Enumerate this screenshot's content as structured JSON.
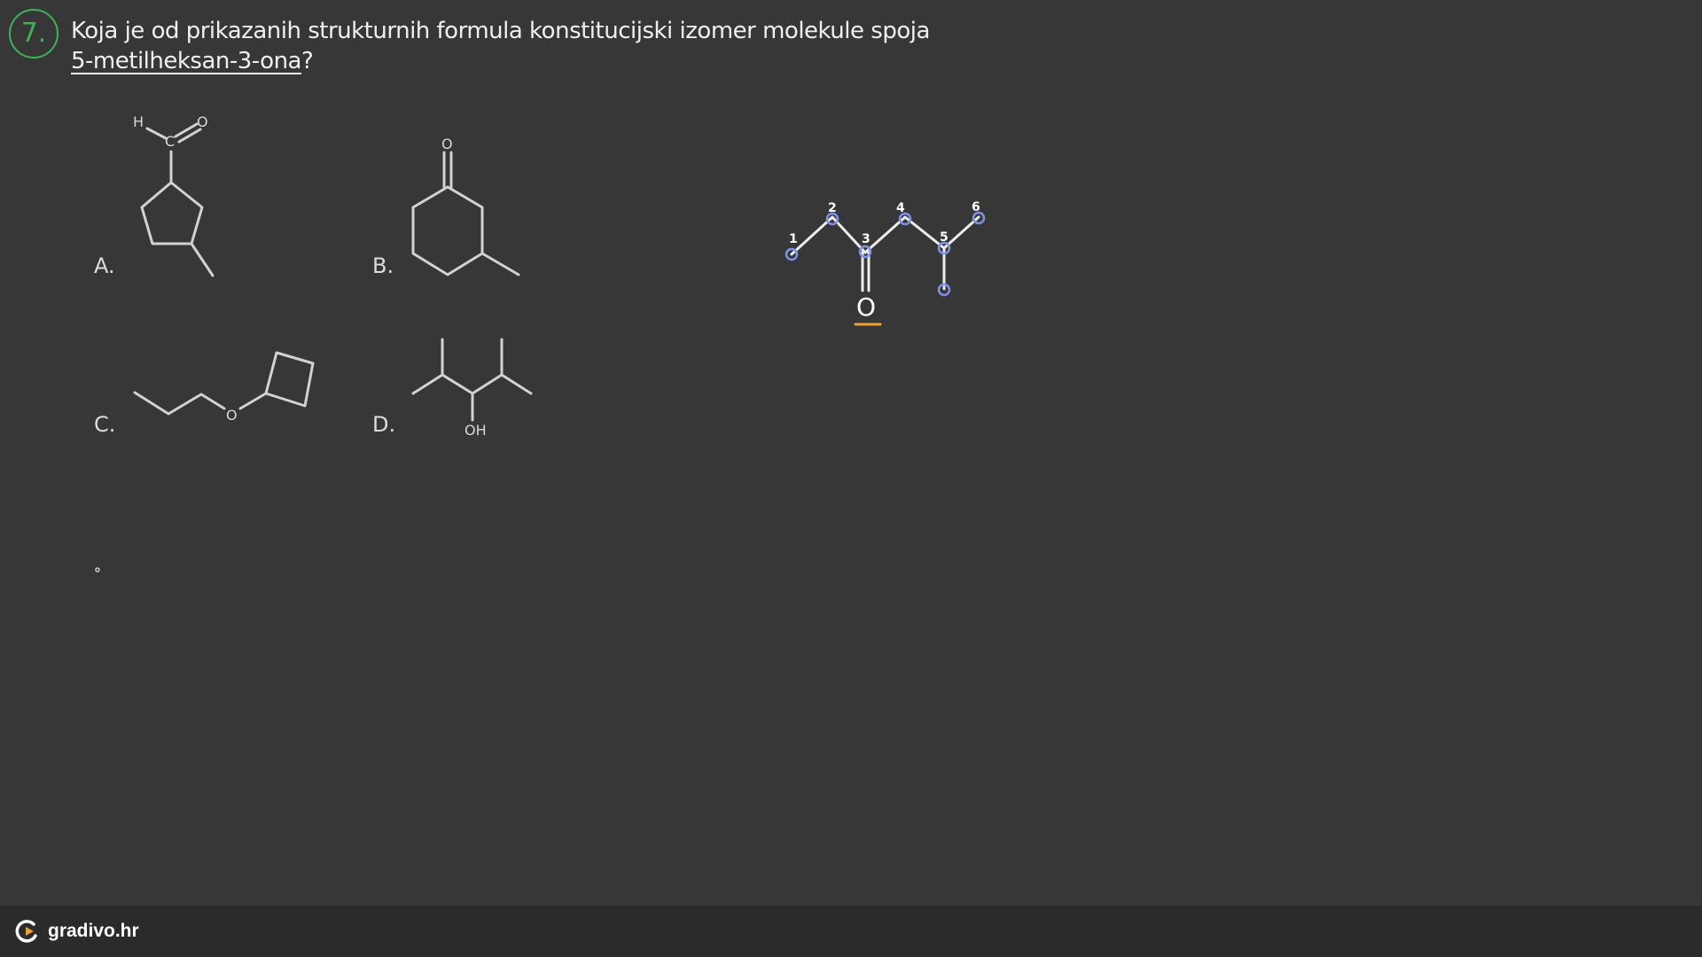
{
  "question": {
    "number": "7.",
    "text_line1": "Koja je od prikazanih strukturnih formula konstitucijski izomer molekule spoja",
    "compound_name": "5-metilheksan-3-ona",
    "end_mark": "?"
  },
  "options": [
    {
      "label": "A.",
      "atoms": [
        "H",
        "C",
        "O"
      ]
    },
    {
      "label": "B.",
      "atoms": [
        "O"
      ]
    },
    {
      "label": "C.",
      "atoms": [
        "O"
      ]
    },
    {
      "label": "D.",
      "atoms": [
        "OH"
      ]
    }
  ],
  "annotation": {
    "carbon_numbers": [
      "1",
      "2",
      "3",
      "4",
      "5",
      "6"
    ],
    "oxygen_label": "O",
    "highlight_color": "#7f93e6",
    "underline_color": "#f0a030"
  },
  "footer": {
    "brand": "gradivo.hr"
  }
}
